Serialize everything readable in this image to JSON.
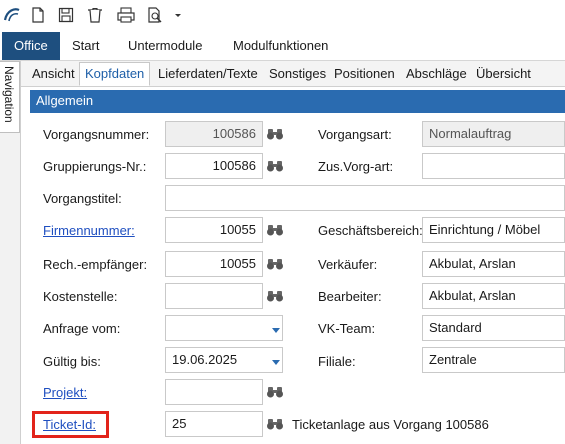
{
  "quick_access": {
    "icons": [
      "app-logo-icon",
      "new-document-icon",
      "save-icon",
      "delete-icon",
      "print-icon",
      "print-preview-icon",
      "customize-arrow-icon"
    ]
  },
  "ribbon": {
    "tabs": [
      "Office",
      "Start",
      "Untermodule",
      "Modulfunktionen"
    ]
  },
  "navigation": {
    "label": "Navigation"
  },
  "subtabs": [
    "Ansicht",
    "Kopfdaten",
    "Lieferdaten/Texte",
    "Sonstiges",
    "Positionen",
    "Abschläge",
    "Übersicht"
  ],
  "section": {
    "title": "Allgemein"
  },
  "form": {
    "vorgangsnummer": {
      "label": "Vorgangsnummer:",
      "value": "100586"
    },
    "vorgangsart": {
      "label": "Vorgangsart:",
      "value": "Normalauftrag"
    },
    "gruppierungsnr": {
      "label": "Gruppierungs-Nr.:",
      "value": "100586"
    },
    "zus_vorg_art": {
      "label": "Zus.Vorg-art:",
      "value": ""
    },
    "vorgangstitel": {
      "label": "Vorgangstitel:",
      "value": ""
    },
    "firmennummer": {
      "label": "Firmennummer:",
      "value": "10055"
    },
    "geschaeftsbereich": {
      "label": "Geschäftsbereich:",
      "value": "Einrichtung / Möbel"
    },
    "rech_empfaenger": {
      "label": "Rech.-empfänger:",
      "value": "10055"
    },
    "verkaeufer": {
      "label": "Verkäufer:",
      "value": "Akbulat, Arslan"
    },
    "kostenstelle": {
      "label": "Kostenstelle:",
      "value": ""
    },
    "bearbeiter": {
      "label": "Bearbeiter:",
      "value": "Akbulat, Arslan"
    },
    "anfrage_vom": {
      "label": "Anfrage vom:",
      "value": ""
    },
    "vk_team": {
      "label": "VK-Team:",
      "value": "Standard"
    },
    "gueltig_bis": {
      "label": "Gültig bis:",
      "value": "19.06.2025"
    },
    "filiale": {
      "label": "Filiale:",
      "value": "Zentrale"
    },
    "projekt": {
      "label": "Projekt:",
      "value": ""
    },
    "ticket_id": {
      "label": "Ticket-Id:",
      "value": "25",
      "note": "Ticketanlage aus Vorgang 100586"
    }
  },
  "colors": {
    "office_tab": "#1e4f7f",
    "section_header": "#2a6bb0",
    "link": "#1f4fc0",
    "highlight": "#e2231a"
  }
}
